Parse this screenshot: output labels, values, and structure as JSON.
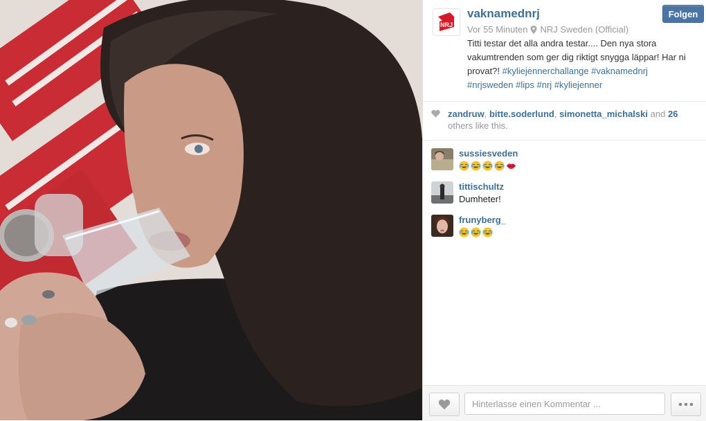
{
  "post": {
    "username": "vaknamednrj",
    "follow_label": "Folgen",
    "time": "Vor 55 Minuten",
    "location": "NRJ Sweden (Official)",
    "caption_text": "Titti testar det alla andra testar.... Den nya stora vakumtrenden som ger dig riktigt snygga läppar! Har ni provat?!",
    "hashtags": [
      "#kyliejennerchallange",
      "#vaknamednrj",
      "#nrjsweden",
      "#lips",
      "#nrj",
      "#kyliejenner"
    ]
  },
  "likes": {
    "users": [
      "zandruw",
      "bitte.soderlund",
      "simonetta_michalski"
    ],
    "and_label": "and",
    "count": "26",
    "suffix": "others like this."
  },
  "comments": [
    {
      "user": "sussiesveden",
      "text": "",
      "emojis": [
        "laugh-cry",
        "laugh-cry",
        "laugh-cry",
        "laugh-cry",
        "lips"
      ]
    },
    {
      "user": "tittischultz",
      "text": "Dumheter!",
      "emojis": []
    },
    {
      "user": "frunyberg_",
      "text": "",
      "emojis": [
        "laugh-cry",
        "laugh-cry",
        "laugh-cry"
      ]
    }
  ],
  "footer": {
    "comment_placeholder": "Hinterlasse einen Kommentar ..."
  },
  "colors": {
    "link": "#3e7096",
    "follow_bg": "#4a74a6",
    "nrj_red": "#d7182a"
  }
}
